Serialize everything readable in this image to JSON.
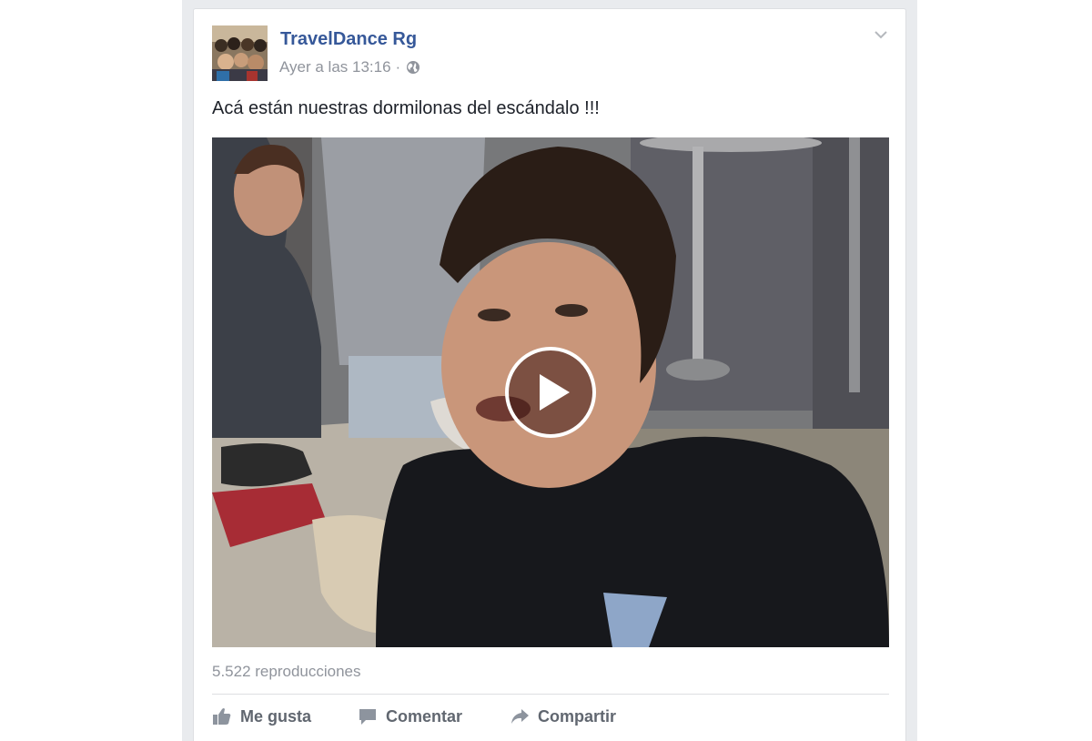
{
  "post": {
    "author": "TravelDance Rg",
    "timestamp": "Ayer a las 13:16",
    "separator": "·",
    "privacy_icon": "globe-icon",
    "menu_icon": "chevron-down-icon",
    "text": "Acá están nuestras dormilonas del escándalo !!!",
    "video": {
      "play_icon": "play-icon",
      "views": "5.522 reproducciones"
    },
    "actions": [
      {
        "label": "Me gusta",
        "icon": "thumbs-up-icon"
      },
      {
        "label": "Comentar",
        "icon": "comment-icon"
      },
      {
        "label": "Compartir",
        "icon": "share-icon"
      }
    ]
  },
  "colors": {
    "author_link": "#365899",
    "meta_text": "#90949c",
    "body_text": "#1d2129",
    "action_text": "#616770",
    "feed_background": "#e9ebee"
  }
}
